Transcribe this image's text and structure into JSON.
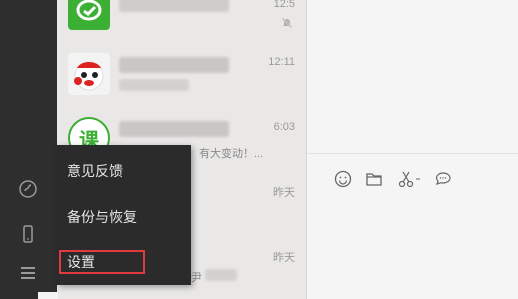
{
  "sidebar": {
    "icons": [
      "mini-program-icon",
      "phone-icon",
      "menu-icon"
    ]
  },
  "chats": [
    {
      "time": "12:5",
      "snippet": "",
      "avatar": "wechat-green-icon"
    },
    {
      "time": "12:11",
      "snippet": "",
      "avatar": "red-mascot-avatar"
    },
    {
      "time": "6:03",
      "snippet": "有大变动！...",
      "avatar": "green-ke-avatar",
      "avatar_text": "课"
    },
    {
      "time": "昨天",
      "snippet": ""
    },
    {
      "time": "昨天",
      "snippet": ""
    },
    {
      "time": "",
      "snippet": "尹"
    }
  ],
  "toolbar": {
    "icons": [
      "emoji-icon",
      "folder-icon",
      "scissors-icon",
      "chat-bubble-icon"
    ]
  },
  "menu": {
    "items": [
      {
        "label": "意见反馈"
      },
      {
        "label": "备份与恢复"
      },
      {
        "label": "设置"
      }
    ]
  },
  "colors": {
    "sidebar_bg": "#2e2e2e",
    "menu_bg": "#2b2b2b",
    "highlight": "#e0393e",
    "wechat_green": "#3cb034"
  }
}
